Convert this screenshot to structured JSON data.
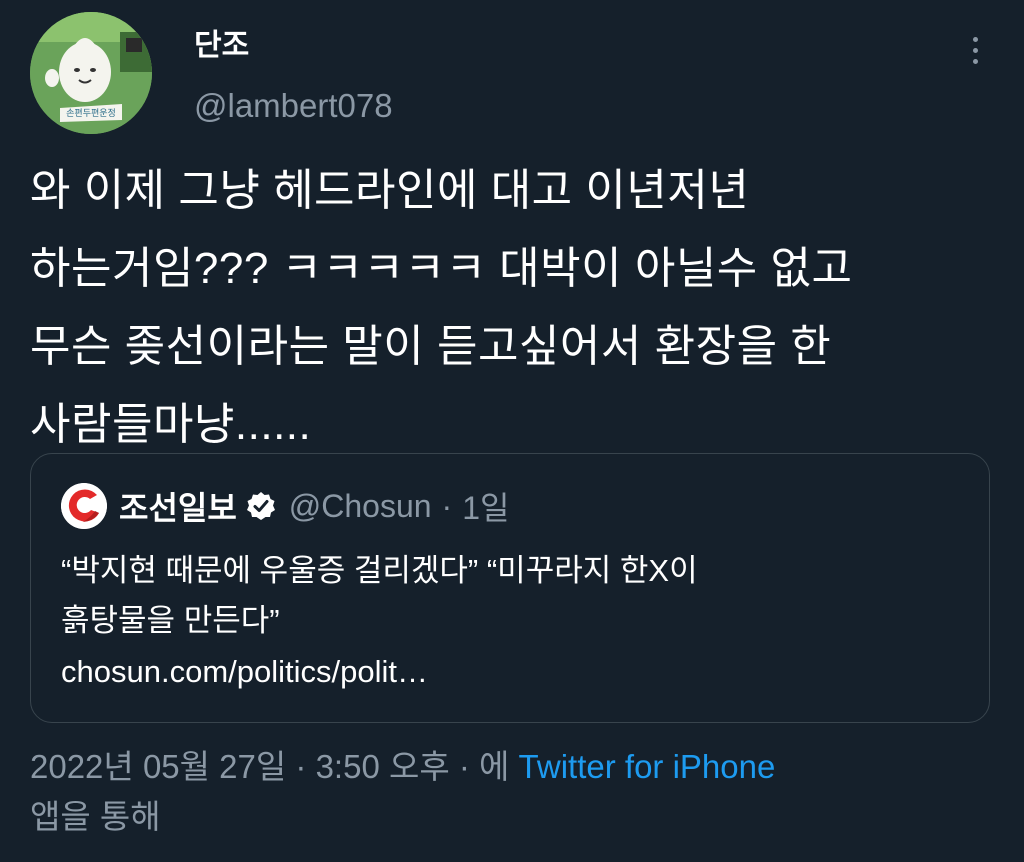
{
  "author": {
    "display_name": "단조",
    "handle": "@lambert078",
    "avatar_caption": "손편두편운정"
  },
  "tweet": {
    "lines": [
      "와 이제 그냥 헤드라인에 대고 이년저년",
      "하는거임??? ㅋㅋㅋㅋㅋ 대박이 아닐수 없고",
      "무슨 좆선이라는 말이 듣고싶어서 환장을 한",
      "사람들마냥......"
    ]
  },
  "quoted_tweet": {
    "name": "조선일보",
    "handle": "@Chosun",
    "separator": "·",
    "time": "1일",
    "body_lines": [
      "“박지현 때문에 우울증 걸리겠다” “미꾸라지 한X이",
      "흙탕물을 만든다”"
    ],
    "link": "chosun.com/politics/polit…",
    "logo_color": "#e32a2a"
  },
  "meta": {
    "timestamp": "2022년 05월 27일 · 3:50 오후 · 에",
    "source": "Twitter for iPhone",
    "suffix": "앱을 통해"
  },
  "colors": {
    "background": "#15202b",
    "secondary_text": "#8b98a5",
    "link": "#1d9bf0",
    "border": "#38444d"
  },
  "icons": {
    "more": "more-vertical-icon",
    "verified": "verified-badge-icon"
  }
}
